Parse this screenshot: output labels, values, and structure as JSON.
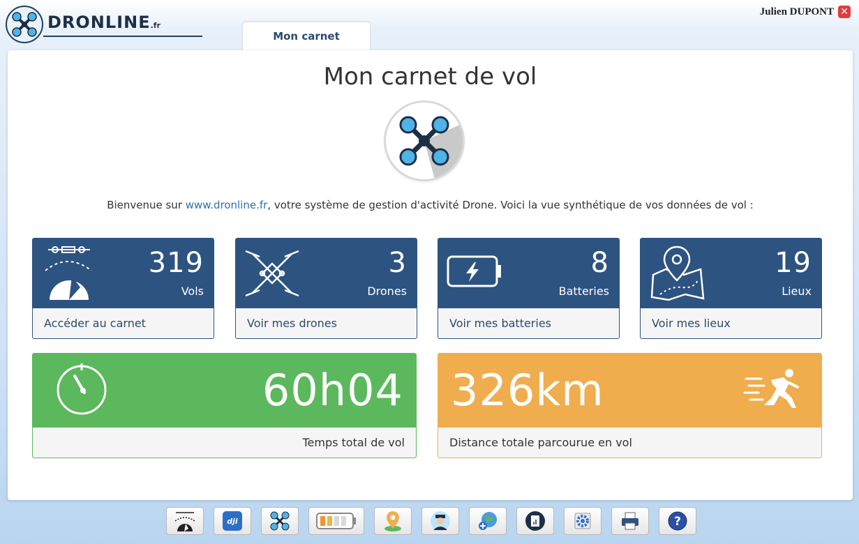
{
  "header": {
    "logo_text": "DRONLINE",
    "logo_suffix": ".fr",
    "user_name": "Julien DUPONT",
    "close_glyph": "✕",
    "tab_label": "Mon carnet"
  },
  "main": {
    "title": "Mon carnet de vol",
    "welcome_prefix": "Bienvenue sur ",
    "welcome_link": "www.dronline.fr",
    "welcome_suffix": ", votre système de gestion d'activité Drone. Voici la vue synthétique de vos données de vol :"
  },
  "cards": [
    {
      "value": "319",
      "label": "Vols",
      "link": "Accéder au carnet",
      "icon": "flight-gauge-icon"
    },
    {
      "value": "3",
      "label": "Drones",
      "link": "Voir mes drones",
      "icon": "drone-icon"
    },
    {
      "value": "8",
      "label": "Batteries",
      "link": "Voir mes batteries",
      "icon": "battery-icon"
    },
    {
      "value": "19",
      "label": "Lieux",
      "link": "Voir mes lieux",
      "icon": "map-pin-icon"
    }
  ],
  "totals": {
    "time_value": "60h04",
    "time_label": "Temps total de vol",
    "distance_value": "326km",
    "distance_label": "Distance totale parcourue en vol"
  },
  "toolbar": [
    "flight-gauge-icon",
    "dji-icon",
    "drone-icon",
    "battery-icon",
    "map-pin-icon",
    "pilot-icon",
    "globe-add-icon",
    "report-icon",
    "settings-icon",
    "print-icon",
    "help-icon"
  ],
  "colors": {
    "card_blue": "#2d5380",
    "green": "#5cb85c",
    "orange": "#f0ad4e",
    "link_blue": "#2f6fad",
    "drone_cyan": "#4fb3e8"
  }
}
